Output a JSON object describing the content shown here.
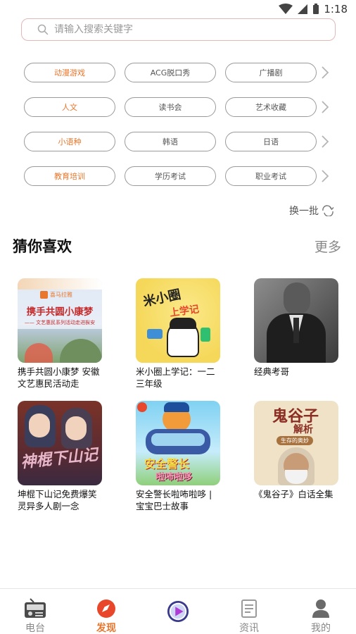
{
  "status": {
    "time": "1:18"
  },
  "search": {
    "placeholder": "请输入搜索关键字"
  },
  "categories": [
    [
      {
        "label": "动漫游戏",
        "accent": true
      },
      {
        "label": "ACG脱口秀"
      },
      {
        "label": "广播剧"
      }
    ],
    [
      {
        "label": "人文",
        "accent": true
      },
      {
        "label": "读书会"
      },
      {
        "label": "艺术收藏"
      }
    ],
    [
      {
        "label": "小语种",
        "accent": true
      },
      {
        "label": "韩语"
      },
      {
        "label": "日语"
      }
    ],
    [
      {
        "label": "教育培训",
        "accent": true
      },
      {
        "label": "学历考试"
      },
      {
        "label": "职业考试"
      }
    ]
  ],
  "refresh_label": "换一批",
  "section": {
    "title": "猜你喜欢",
    "more": "更多"
  },
  "cards": [
    {
      "title": "携手共圆小康梦 安徽文艺惠民活动走",
      "cover_title": "携手共圆小康梦",
      "cover_subtitle": "—— 文艺惠民系列活动走进枞安",
      "cover_brand": "喜马拉雅"
    },
    {
      "title": "米小圈上学记：一二三年级",
      "cover_title": "米小圈",
      "cover_subtitle": "上学记"
    },
    {
      "title": "经典考哥"
    },
    {
      "title": "坤棍下山记免费爆笑灵异多人剧一念",
      "cover_title": "神棍下山记"
    },
    {
      "title": "安全警长啦咘啦哆 | 宝宝巴士故事",
      "cover_title": "安全警长",
      "cover_subtitle": "啦咘啦哆"
    },
    {
      "title": "《鬼谷子》白话全集",
      "cover_title": "鬼谷子",
      "cover_subtitle": "解析",
      "cover_tag": "生存的奥妙"
    }
  ],
  "tabs": [
    {
      "label": "电台",
      "active": false
    },
    {
      "label": "发现",
      "active": true
    },
    {
      "label": "",
      "active": false
    },
    {
      "label": "资讯",
      "active": false
    },
    {
      "label": "我的",
      "active": false
    }
  ],
  "colors": {
    "accent": "#e8762c",
    "search_border": "#e2b8b8",
    "chip_border": "#9a9a9a"
  }
}
